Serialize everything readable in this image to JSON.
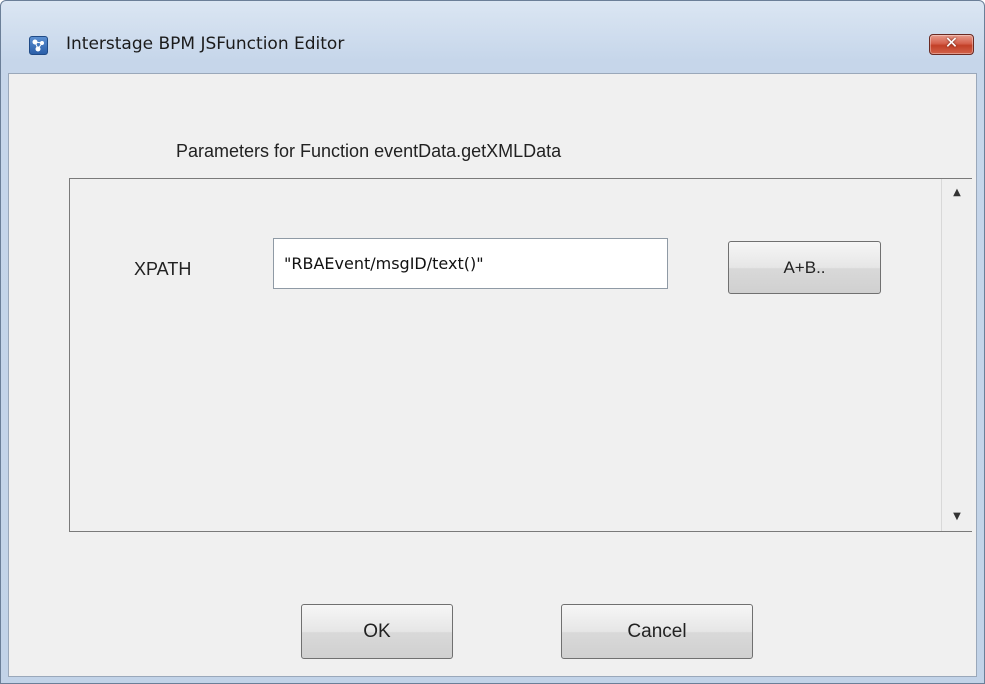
{
  "window": {
    "title": "Interstage BPM JSFunction Editor",
    "icon": "app-logo-icon",
    "close_label": "✕"
  },
  "dialog": {
    "heading": "Parameters for Function eventData.getXMLData",
    "parameters": [
      {
        "label": "XPATH",
        "value": "\"RBAEvent/msgID/text()\"",
        "builder_button": "A+B.."
      }
    ],
    "scroll_up": "▲",
    "scroll_down": "▼"
  },
  "buttons": {
    "ok": "OK",
    "cancel": "Cancel"
  },
  "colors": {
    "title_bar": "#c8d8ec",
    "client_bg": "#f0f0f0",
    "close_button": "#c8442d"
  }
}
